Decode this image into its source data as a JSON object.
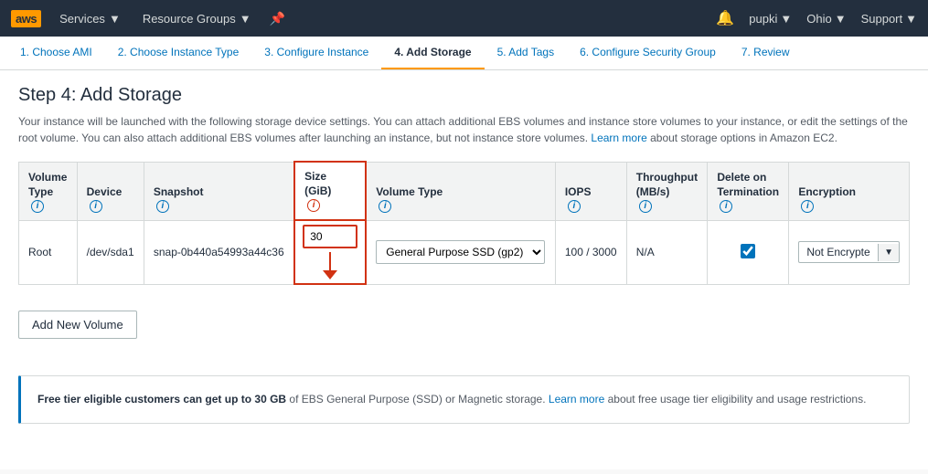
{
  "topNav": {
    "logo": "aws",
    "services_label": "Services",
    "resource_groups_label": "Resource Groups",
    "user": "pupki",
    "region": "Ohio",
    "support": "Support"
  },
  "stepTabs": [
    {
      "id": "ami",
      "label": "1. Choose AMI",
      "active": false
    },
    {
      "id": "instance-type",
      "label": "2. Choose Instance Type",
      "active": false
    },
    {
      "id": "configure-instance",
      "label": "3. Configure Instance",
      "active": false
    },
    {
      "id": "add-storage",
      "label": "4. Add Storage",
      "active": true
    },
    {
      "id": "add-tags",
      "label": "5. Add Tags",
      "active": false
    },
    {
      "id": "security-group",
      "label": "6. Configure Security Group",
      "active": false
    },
    {
      "id": "review",
      "label": "7. Review",
      "active": false
    }
  ],
  "page": {
    "title": "Step 4: Add Storage",
    "description": "Your instance will be launched with the following storage device settings. You can attach additional EBS volumes and instance store volumes to your instance, or edit the settings of the root volume. You can also attach additional EBS volumes after launching an instance, but not instance store volumes.",
    "learn_more": "Learn more",
    "desc_suffix": "about storage options in Amazon EC2."
  },
  "table": {
    "columns": [
      {
        "id": "volume-type",
        "label": "Volume Type"
      },
      {
        "id": "device",
        "label": "Device"
      },
      {
        "id": "snapshot",
        "label": "Snapshot"
      },
      {
        "id": "size-gib",
        "label": "Size (GiB)"
      },
      {
        "id": "volume-type-col",
        "label": "Volume Type"
      },
      {
        "id": "iops",
        "label": "IOPS"
      },
      {
        "id": "throughput",
        "label": "Throughput (MB/s)"
      },
      {
        "id": "delete-on-term",
        "label": "Delete on Termination"
      },
      {
        "id": "encryption",
        "label": "Encryption"
      }
    ],
    "rows": [
      {
        "volume_type": "Root",
        "device": "/dev/sda1",
        "snapshot": "snap-0b440a54993a44c36",
        "size": "30",
        "vol_type_value": "General Purpos",
        "iops": "100 / 3000",
        "throughput": "N/A",
        "delete_on_term": true,
        "encryption": "Not Encrypte"
      }
    ]
  },
  "buttons": {
    "add_volume": "Add New Volume"
  },
  "infoBox": {
    "bold_text": "Free tier eligible customers can get up to 30 GB",
    "text": " of EBS General Purpose (SSD) or Magnetic storage.",
    "learn_more": "Learn more",
    "suffix": " about free usage tier eligibility and usage restrictions."
  }
}
